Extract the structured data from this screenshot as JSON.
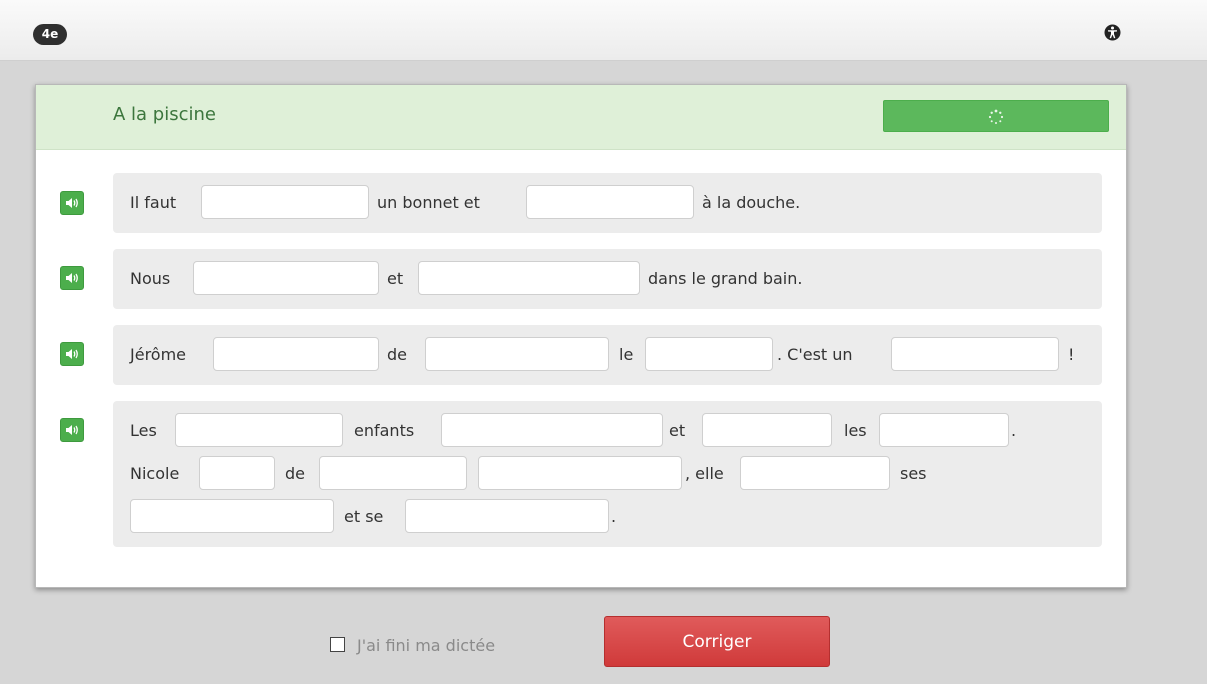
{
  "header": {
    "level_badge": "4e",
    "accessibility_icon": "accessibility-icon"
  },
  "exercise": {
    "title": "A la piscine",
    "progress_icon": "spinner-icon",
    "speaker_icon": "speaker-icon",
    "sentences": [
      {
        "words": [
          "Il faut",
          "un bonnet et",
          "à la douche."
        ],
        "blanks": [
          "",
          ""
        ]
      },
      {
        "words": [
          "Nous",
          "et",
          "dans le grand bain."
        ],
        "blanks": [
          "",
          ""
        ]
      },
      {
        "words": [
          "Jérôme",
          "de",
          "le",
          ". C'est un",
          "!"
        ],
        "blanks": [
          "",
          "",
          "",
          ""
        ]
      },
      {
        "words": [
          "Les",
          "enfants",
          "et",
          "les",
          ".",
          "Nicole",
          "de",
          ", elle",
          "ses",
          "et se",
          "."
        ],
        "blanks": [
          "",
          "",
          "",
          "",
          "",
          "",
          "",
          "",
          "",
          ""
        ]
      }
    ]
  },
  "footer": {
    "finished_label": "J'ai fini ma dictée",
    "finished_checked": false,
    "submit_label": "Corriger"
  },
  "colors": {
    "header_green_bg": "#dff0d8",
    "title_green": "#3c763d",
    "button_green": "#5cb85c",
    "submit_red": "#d9534f"
  }
}
